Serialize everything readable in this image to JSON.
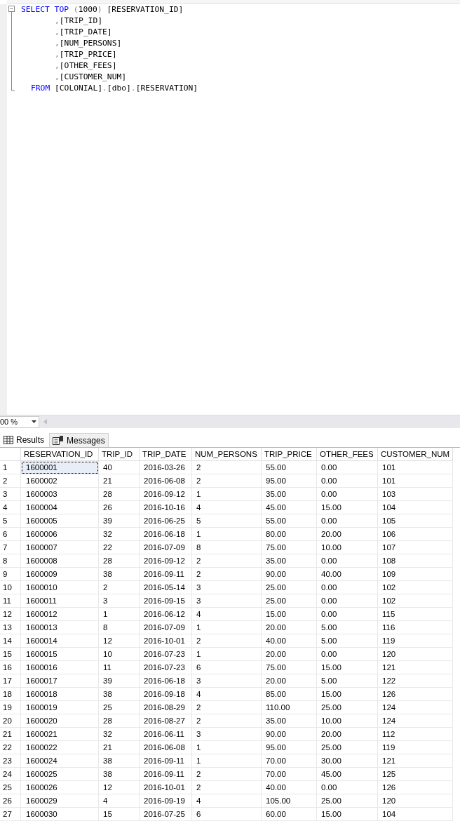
{
  "editor": {
    "lines": [
      {
        "kind": "select",
        "tokens": [
          {
            "kind": "keyword",
            "text": "SELECT TOP "
          },
          {
            "kind": "punct",
            "text": "("
          },
          {
            "kind": "plain",
            "text": "1000"
          },
          {
            "kind": "punct",
            "text": ")"
          },
          {
            "kind": "plain",
            "text": " [RESERVATION_ID]"
          }
        ]
      },
      {
        "kind": "column",
        "tokens": [
          {
            "kind": "punct",
            "text": ","
          },
          {
            "kind": "plain",
            "text": "[TRIP_ID]"
          }
        ]
      },
      {
        "kind": "column",
        "tokens": [
          {
            "kind": "punct",
            "text": ","
          },
          {
            "kind": "plain",
            "text": "[TRIP_DATE]"
          }
        ]
      },
      {
        "kind": "column",
        "tokens": [
          {
            "kind": "punct",
            "text": ","
          },
          {
            "kind": "plain",
            "text": "[NUM_PERSONS]"
          }
        ]
      },
      {
        "kind": "column",
        "tokens": [
          {
            "kind": "punct",
            "text": ","
          },
          {
            "kind": "plain",
            "text": "[TRIP_PRICE]"
          }
        ]
      },
      {
        "kind": "column",
        "tokens": [
          {
            "kind": "punct",
            "text": ","
          },
          {
            "kind": "plain",
            "text": "[OTHER_FEES]"
          }
        ]
      },
      {
        "kind": "column",
        "tokens": [
          {
            "kind": "punct",
            "text": ","
          },
          {
            "kind": "plain",
            "text": "[CUSTOMER_NUM]"
          }
        ]
      },
      {
        "kind": "from",
        "tokens": [
          {
            "kind": "keyword",
            "text": "FROM "
          },
          {
            "kind": "plain",
            "text": "[COLONIAL]"
          },
          {
            "kind": "punct",
            "text": "."
          },
          {
            "kind": "plain",
            "text": "[dbo]"
          },
          {
            "kind": "punct",
            "text": "."
          },
          {
            "kind": "plain",
            "text": "[RESERVATION]"
          }
        ]
      }
    ]
  },
  "zoom": {
    "value": "00 %"
  },
  "tabs": [
    {
      "label": "Results",
      "kind": "grid",
      "selected": true
    },
    {
      "label": "Messages",
      "kind": "messages",
      "selected": false
    }
  ],
  "table": {
    "columns": [
      "RESERVATION_ID",
      "TRIP_ID",
      "TRIP_DATE",
      "NUM_PERSONS",
      "TRIP_PRICE",
      "OTHER_FEES",
      "CUSTOMER_NUM"
    ],
    "rows": [
      {
        "number": "1",
        "selected": true,
        "cells": [
          "1600001",
          "40",
          "2016-03-26",
          "2",
          "55.00",
          "0.00",
          "101"
        ]
      },
      {
        "number": "2",
        "selected": false,
        "cells": [
          "1600002",
          "21",
          "2016-06-08",
          "2",
          "95.00",
          "0.00",
          "101"
        ]
      },
      {
        "number": "3",
        "selected": false,
        "cells": [
          "1600003",
          "28",
          "2016-09-12",
          "1",
          "35.00",
          "0.00",
          "103"
        ]
      },
      {
        "number": "4",
        "selected": false,
        "cells": [
          "1600004",
          "26",
          "2016-10-16",
          "4",
          "45.00",
          "15.00",
          "104"
        ]
      },
      {
        "number": "5",
        "selected": false,
        "cells": [
          "1600005",
          "39",
          "2016-06-25",
          "5",
          "55.00",
          "0.00",
          "105"
        ]
      },
      {
        "number": "6",
        "selected": false,
        "cells": [
          "1600006",
          "32",
          "2016-06-18",
          "1",
          "80.00",
          "20.00",
          "106"
        ]
      },
      {
        "number": "7",
        "selected": false,
        "cells": [
          "1600007",
          "22",
          "2016-07-09",
          "8",
          "75.00",
          "10.00",
          "107"
        ]
      },
      {
        "number": "8",
        "selected": false,
        "cells": [
          "1600008",
          "28",
          "2016-09-12",
          "2",
          "35.00",
          "0.00",
          "108"
        ]
      },
      {
        "number": "9",
        "selected": false,
        "cells": [
          "1600009",
          "38",
          "2016-09-11",
          "2",
          "90.00",
          "40.00",
          "109"
        ]
      },
      {
        "number": "10",
        "selected": false,
        "cells": [
          "1600010",
          "2",
          "2016-05-14",
          "3",
          "25.00",
          "0.00",
          "102"
        ]
      },
      {
        "number": "11",
        "selected": false,
        "cells": [
          "1600011",
          "3",
          "2016-09-15",
          "3",
          "25.00",
          "0.00",
          "102"
        ]
      },
      {
        "number": "12",
        "selected": false,
        "cells": [
          "1600012",
          "1",
          "2016-06-12",
          "4",
          "15.00",
          "0.00",
          "115"
        ]
      },
      {
        "number": "13",
        "selected": false,
        "cells": [
          "1600013",
          "8",
          "2016-07-09",
          "1",
          "20.00",
          "5.00",
          "116"
        ]
      },
      {
        "number": "14",
        "selected": false,
        "cells": [
          "1600014",
          "12",
          "2016-10-01",
          "2",
          "40.00",
          "5.00",
          "119"
        ]
      },
      {
        "number": "15",
        "selected": false,
        "cells": [
          "1600015",
          "10",
          "2016-07-23",
          "1",
          "20.00",
          "0.00",
          "120"
        ]
      },
      {
        "number": "16",
        "selected": false,
        "cells": [
          "1600016",
          "11",
          "2016-07-23",
          "6",
          "75.00",
          "15.00",
          "121"
        ]
      },
      {
        "number": "17",
        "selected": false,
        "cells": [
          "1600017",
          "39",
          "2016-06-18",
          "3",
          "20.00",
          "5.00",
          "122"
        ]
      },
      {
        "number": "18",
        "selected": false,
        "cells": [
          "1600018",
          "38",
          "2016-09-18",
          "4",
          "85.00",
          "15.00",
          "126"
        ]
      },
      {
        "number": "19",
        "selected": false,
        "cells": [
          "1600019",
          "25",
          "2016-08-29",
          "2",
          "110.00",
          "25.00",
          "124"
        ]
      },
      {
        "number": "20",
        "selected": false,
        "cells": [
          "1600020",
          "28",
          "2016-08-27",
          "2",
          "35.00",
          "10.00",
          "124"
        ]
      },
      {
        "number": "21",
        "selected": false,
        "cells": [
          "1600021",
          "32",
          "2016-06-11",
          "3",
          "90.00",
          "20.00",
          "112"
        ]
      },
      {
        "number": "22",
        "selected": false,
        "cells": [
          "1600022",
          "21",
          "2016-06-08",
          "1",
          "95.00",
          "25.00",
          "119"
        ]
      },
      {
        "number": "23",
        "selected": false,
        "cells": [
          "1600024",
          "38",
          "2016-09-11",
          "1",
          "70.00",
          "30.00",
          "121"
        ]
      },
      {
        "number": "24",
        "selected": false,
        "cells": [
          "1600025",
          "38",
          "2016-09-11",
          "2",
          "70.00",
          "45.00",
          "125"
        ]
      },
      {
        "number": "25",
        "selected": false,
        "cells": [
          "1600026",
          "12",
          "2016-10-01",
          "2",
          "40.00",
          "0.00",
          "126"
        ]
      },
      {
        "number": "26",
        "selected": false,
        "cells": [
          "1600029",
          "4",
          "2016-09-19",
          "4",
          "105.00",
          "25.00",
          "120"
        ]
      },
      {
        "number": "27",
        "selected": false,
        "cells": [
          "1600030",
          "15",
          "2016-07-25",
          "6",
          "60.00",
          "15.00",
          "104"
        ]
      }
    ]
  }
}
